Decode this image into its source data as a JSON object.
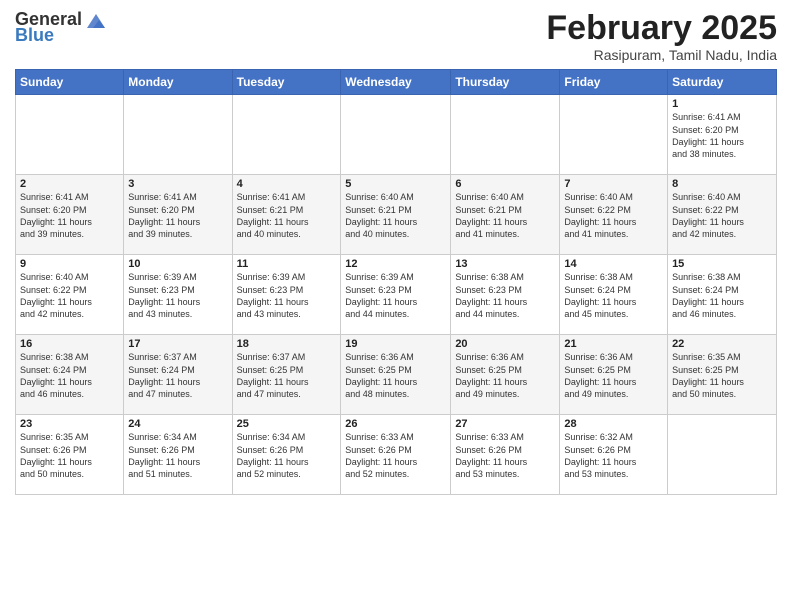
{
  "header": {
    "logo_general": "General",
    "logo_blue": "Blue",
    "month_title": "February 2025",
    "location": "Rasipuram, Tamil Nadu, India"
  },
  "days_of_week": [
    "Sunday",
    "Monday",
    "Tuesday",
    "Wednesday",
    "Thursday",
    "Friday",
    "Saturday"
  ],
  "weeks": [
    [
      {
        "day": "",
        "info": ""
      },
      {
        "day": "",
        "info": ""
      },
      {
        "day": "",
        "info": ""
      },
      {
        "day": "",
        "info": ""
      },
      {
        "day": "",
        "info": ""
      },
      {
        "day": "",
        "info": ""
      },
      {
        "day": "1",
        "info": "Sunrise: 6:41 AM\nSunset: 6:20 PM\nDaylight: 11 hours\nand 38 minutes."
      }
    ],
    [
      {
        "day": "2",
        "info": "Sunrise: 6:41 AM\nSunset: 6:20 PM\nDaylight: 11 hours\nand 39 minutes."
      },
      {
        "day": "3",
        "info": "Sunrise: 6:41 AM\nSunset: 6:20 PM\nDaylight: 11 hours\nand 39 minutes."
      },
      {
        "day": "4",
        "info": "Sunrise: 6:41 AM\nSunset: 6:21 PM\nDaylight: 11 hours\nand 40 minutes."
      },
      {
        "day": "5",
        "info": "Sunrise: 6:40 AM\nSunset: 6:21 PM\nDaylight: 11 hours\nand 40 minutes."
      },
      {
        "day": "6",
        "info": "Sunrise: 6:40 AM\nSunset: 6:21 PM\nDaylight: 11 hours\nand 41 minutes."
      },
      {
        "day": "7",
        "info": "Sunrise: 6:40 AM\nSunset: 6:22 PM\nDaylight: 11 hours\nand 41 minutes."
      },
      {
        "day": "8",
        "info": "Sunrise: 6:40 AM\nSunset: 6:22 PM\nDaylight: 11 hours\nand 42 minutes."
      }
    ],
    [
      {
        "day": "9",
        "info": "Sunrise: 6:40 AM\nSunset: 6:22 PM\nDaylight: 11 hours\nand 42 minutes."
      },
      {
        "day": "10",
        "info": "Sunrise: 6:39 AM\nSunset: 6:23 PM\nDaylight: 11 hours\nand 43 minutes."
      },
      {
        "day": "11",
        "info": "Sunrise: 6:39 AM\nSunset: 6:23 PM\nDaylight: 11 hours\nand 43 minutes."
      },
      {
        "day": "12",
        "info": "Sunrise: 6:39 AM\nSunset: 6:23 PM\nDaylight: 11 hours\nand 44 minutes."
      },
      {
        "day": "13",
        "info": "Sunrise: 6:38 AM\nSunset: 6:23 PM\nDaylight: 11 hours\nand 44 minutes."
      },
      {
        "day": "14",
        "info": "Sunrise: 6:38 AM\nSunset: 6:24 PM\nDaylight: 11 hours\nand 45 minutes."
      },
      {
        "day": "15",
        "info": "Sunrise: 6:38 AM\nSunset: 6:24 PM\nDaylight: 11 hours\nand 46 minutes."
      }
    ],
    [
      {
        "day": "16",
        "info": "Sunrise: 6:38 AM\nSunset: 6:24 PM\nDaylight: 11 hours\nand 46 minutes."
      },
      {
        "day": "17",
        "info": "Sunrise: 6:37 AM\nSunset: 6:24 PM\nDaylight: 11 hours\nand 47 minutes."
      },
      {
        "day": "18",
        "info": "Sunrise: 6:37 AM\nSunset: 6:25 PM\nDaylight: 11 hours\nand 47 minutes."
      },
      {
        "day": "19",
        "info": "Sunrise: 6:36 AM\nSunset: 6:25 PM\nDaylight: 11 hours\nand 48 minutes."
      },
      {
        "day": "20",
        "info": "Sunrise: 6:36 AM\nSunset: 6:25 PM\nDaylight: 11 hours\nand 49 minutes."
      },
      {
        "day": "21",
        "info": "Sunrise: 6:36 AM\nSunset: 6:25 PM\nDaylight: 11 hours\nand 49 minutes."
      },
      {
        "day": "22",
        "info": "Sunrise: 6:35 AM\nSunset: 6:25 PM\nDaylight: 11 hours\nand 50 minutes."
      }
    ],
    [
      {
        "day": "23",
        "info": "Sunrise: 6:35 AM\nSunset: 6:26 PM\nDaylight: 11 hours\nand 50 minutes."
      },
      {
        "day": "24",
        "info": "Sunrise: 6:34 AM\nSunset: 6:26 PM\nDaylight: 11 hours\nand 51 minutes."
      },
      {
        "day": "25",
        "info": "Sunrise: 6:34 AM\nSunset: 6:26 PM\nDaylight: 11 hours\nand 52 minutes."
      },
      {
        "day": "26",
        "info": "Sunrise: 6:33 AM\nSunset: 6:26 PM\nDaylight: 11 hours\nand 52 minutes."
      },
      {
        "day": "27",
        "info": "Sunrise: 6:33 AM\nSunset: 6:26 PM\nDaylight: 11 hours\nand 53 minutes."
      },
      {
        "day": "28",
        "info": "Sunrise: 6:32 AM\nSunset: 6:26 PM\nDaylight: 11 hours\nand 53 minutes."
      },
      {
        "day": "",
        "info": ""
      }
    ]
  ]
}
